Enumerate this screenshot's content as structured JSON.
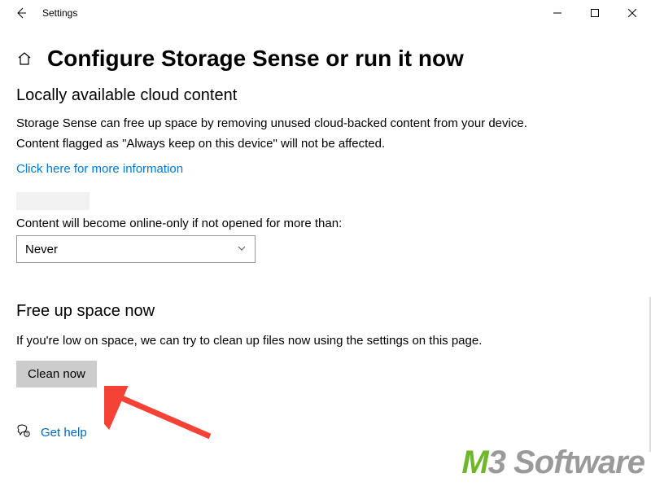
{
  "titlebar": {
    "app_name": "Settings"
  },
  "header": {
    "page_title": "Configure Storage Sense or run it now"
  },
  "cloud": {
    "heading": "Locally available cloud content",
    "desc1": "Storage Sense can free up space by removing unused cloud-backed content from your device.",
    "desc2": "Content flagged as \"Always keep on this device\" will not be affected.",
    "more_link": "Click here for more information",
    "field_label": "Content will become online-only if not opened for more than:",
    "select_value": "Never"
  },
  "free": {
    "heading": "Free up space now",
    "desc": "If you're low on space, we can try to clean up files now using the settings on this page.",
    "button": "Clean now"
  },
  "help": {
    "label": "Get help"
  },
  "watermark": {
    "m": "M",
    "n3": "3",
    "sw": " Software"
  }
}
